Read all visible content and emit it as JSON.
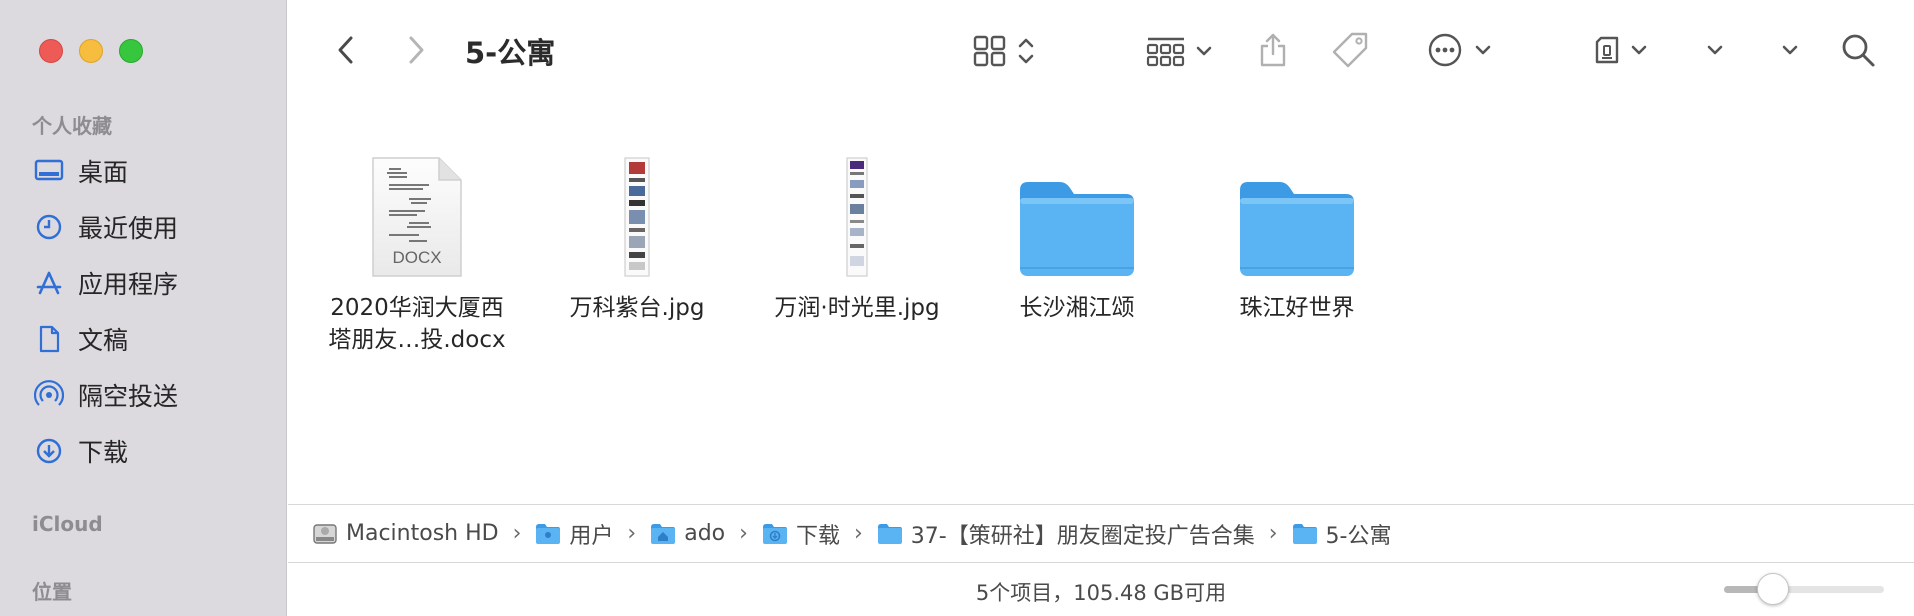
{
  "window": {
    "title": "5-公寓"
  },
  "sidebar": {
    "favorites_heading": "个人收藏",
    "items": [
      {
        "label": "桌面",
        "icon": "desktop-icon"
      },
      {
        "label": "最近使用",
        "icon": "clock-icon"
      },
      {
        "label": "应用程序",
        "icon": "applications-icon"
      },
      {
        "label": "文稿",
        "icon": "document-icon"
      },
      {
        "label": "隔空投送",
        "icon": "airdrop-icon"
      },
      {
        "label": "下载",
        "icon": "download-icon"
      }
    ],
    "icloud_heading": "iCloud",
    "locations_heading": "位置"
  },
  "files": [
    {
      "name_line1": "2020华润大厦西",
      "name_line2": "塔朋友…投.docx",
      "kind": "docx",
      "badge": "DOCX"
    },
    {
      "name_line1": "万科紫台.jpg",
      "name_line2": "",
      "kind": "image"
    },
    {
      "name_line1": "万润·时光里.jpg",
      "name_line2": "",
      "kind": "image"
    },
    {
      "name_line1": "长沙湘江颂",
      "name_line2": "",
      "kind": "folder"
    },
    {
      "name_line1": "珠江好世界",
      "name_line2": "",
      "kind": "folder"
    }
  ],
  "pathbar": [
    {
      "label": "Macintosh HD",
      "icon": "hard-drive-icon"
    },
    {
      "label": "用户",
      "icon": "folder-icon"
    },
    {
      "label": "ado",
      "icon": "home-folder-icon"
    },
    {
      "label": "下载",
      "icon": "downloads-folder-icon"
    },
    {
      "label": "37-【策研社】朋友圈定投广告合集",
      "icon": "folder-icon"
    },
    {
      "label": "5-公寓",
      "icon": "folder-icon"
    }
  ],
  "status": {
    "text": "5个项目，105.48 GB可用",
    "zoom_fraction": 0.25
  },
  "colors": {
    "accent": "#2f6fd6",
    "folder": "#5ab2f2",
    "sidebar_bg": "#dcd9df"
  }
}
